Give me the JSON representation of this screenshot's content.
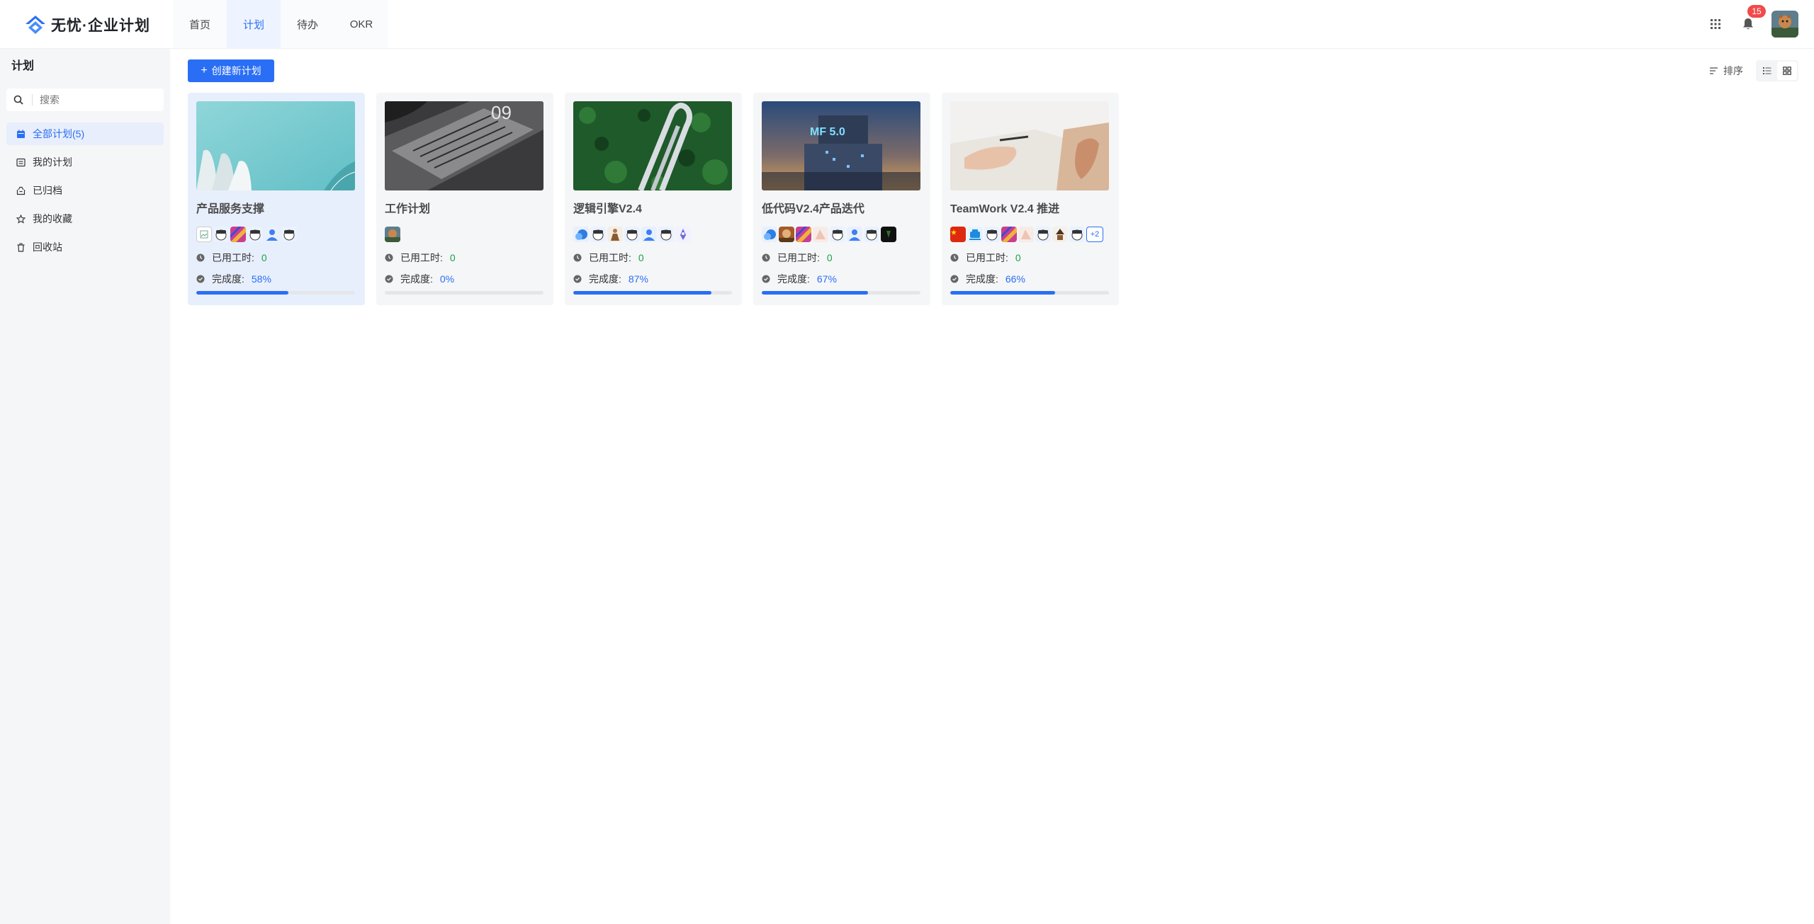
{
  "app": {
    "logo_text": "无忧·企业计划"
  },
  "nav": [
    {
      "label": "首页",
      "active": false
    },
    {
      "label": "计划",
      "active": true
    },
    {
      "label": "待办",
      "active": false
    },
    {
      "label": "OKR",
      "active": false
    }
  ],
  "header": {
    "notification_count": "15"
  },
  "sidebar": {
    "title": "计划",
    "search_placeholder": "搜索",
    "items": [
      {
        "label": "全部计划(5)",
        "icon": "calendar-icon",
        "active": true
      },
      {
        "label": "我的计划",
        "icon": "list-icon",
        "active": false
      },
      {
        "label": "已归档",
        "icon": "archive-icon",
        "active": false
      },
      {
        "label": "我的收藏",
        "icon": "star-icon",
        "active": false
      },
      {
        "label": "回收站",
        "icon": "trash-icon",
        "active": false
      }
    ]
  },
  "toolbar": {
    "create_label": "创建新计划",
    "sort_label": "排序"
  },
  "card_labels": {
    "hours": "已用工时:",
    "completion": "完成度:"
  },
  "plans": [
    {
      "title": "产品服务支撑",
      "hours": "0",
      "completion": "58%",
      "progress": 0.58,
      "more": ""
    },
    {
      "title": "工作计划",
      "hours": "0",
      "completion": "0%",
      "progress": 0.0,
      "more": ""
    },
    {
      "title": "逻辑引擎V2.4",
      "hours": "0",
      "completion": "87%",
      "progress": 0.87,
      "more": ""
    },
    {
      "title": "低代码V2.4产品迭代",
      "hours": "0",
      "completion": "67%",
      "progress": 0.67,
      "more": ""
    },
    {
      "title": "TeamWork V2.4 推进",
      "hours": "0",
      "completion": "66%",
      "progress": 0.66,
      "more": "+2"
    }
  ],
  "colors": {
    "accent": "#2a6ef5",
    "green": "#19a34a",
    "badge": "#f24a4a"
  }
}
